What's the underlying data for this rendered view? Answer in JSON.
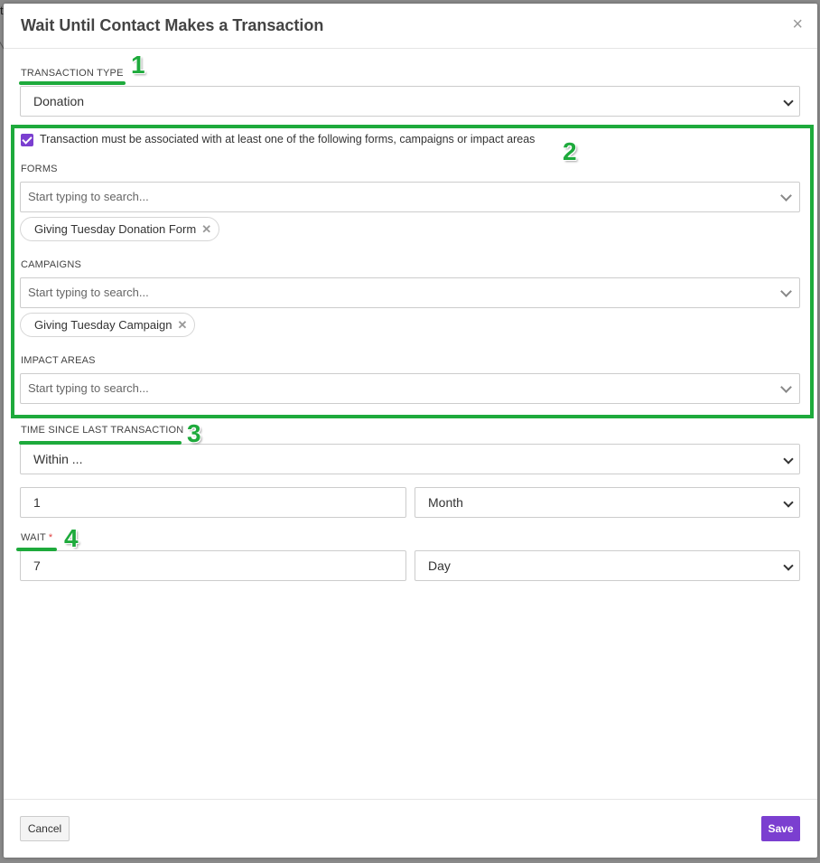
{
  "background_fragment": "t",
  "modal": {
    "title": "Wait Until Contact Makes a Transaction",
    "close_icon": "×"
  },
  "transaction_type": {
    "label": "TRANSACTION TYPE",
    "value": "Donation"
  },
  "association": {
    "checked": true,
    "label": "Transaction must be associated with at least one of the following forms, campaigns or impact areas"
  },
  "forms": {
    "label": "FORMS",
    "placeholder": "Start typing to search...",
    "tags": [
      "Giving Tuesday Donation Form"
    ]
  },
  "campaigns": {
    "label": "CAMPAIGNS",
    "placeholder": "Start typing to search...",
    "tags": [
      "Giving Tuesday Campaign"
    ]
  },
  "impact_areas": {
    "label": "IMPACT AREAS",
    "placeholder": "Start typing to search..."
  },
  "time_since": {
    "label": "TIME SINCE LAST TRANSACTION",
    "mode": "Within ...",
    "amount": "1",
    "unit": "Month"
  },
  "wait": {
    "label": "WAIT",
    "required_mark": "*",
    "amount": "7",
    "unit": "Day"
  },
  "annotations": [
    "1",
    "2",
    "3",
    "4"
  ],
  "annotation_color": "#1eaa3c",
  "footer": {
    "cancel_label": "Cancel",
    "save_label": "Save"
  },
  "colors": {
    "accent": "#7b3fd0",
    "required": "#e04040"
  }
}
